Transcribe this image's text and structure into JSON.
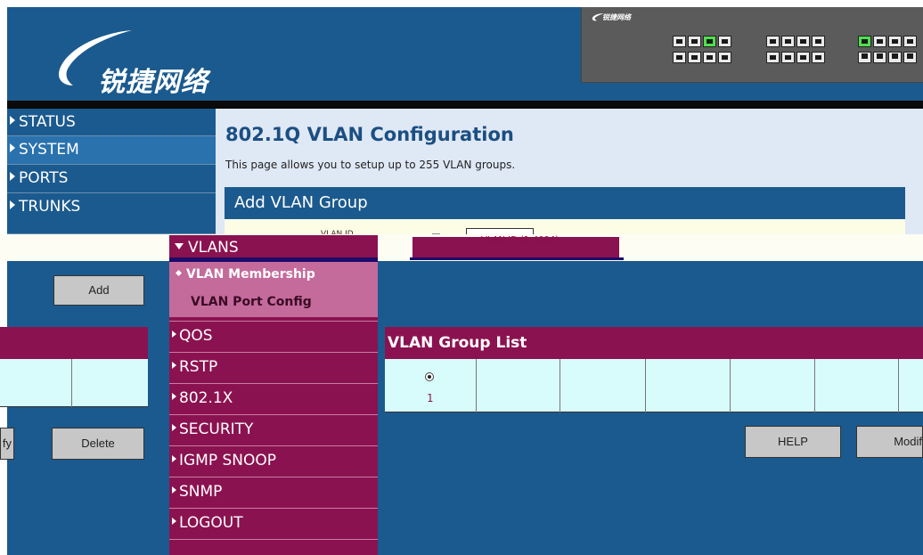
{
  "header": {
    "logo_text": "锐捷网络",
    "switch_brand": "锐捷网络"
  },
  "nav": {
    "items": [
      {
        "label": "STATUS"
      },
      {
        "label": "SYSTEM"
      },
      {
        "label": "PORTS"
      },
      {
        "label": "TRUNKS"
      }
    ],
    "vlans_label": "VLANS",
    "vlan_sub": [
      {
        "label": "VLAN Membership"
      },
      {
        "label": "VLAN Port Config"
      }
    ],
    "more_items": [
      {
        "label": "QOS"
      },
      {
        "label": "RSTP"
      },
      {
        "label": "802.1X"
      },
      {
        "label": "SECURITY"
      },
      {
        "label": "IGMP SNOOP"
      },
      {
        "label": "SNMP"
      },
      {
        "label": "LOGOUT"
      }
    ]
  },
  "main": {
    "title": "802.1Q VLAN Configuration",
    "description": "This page allows you to setup up to 255 VLAN groups.",
    "add_group_header": "Add VLAN Group",
    "vlan_id_label": "VLAN ID",
    "vlan_id_hint": "VLAN ID (1-4094)",
    "group_list_header": "VLAN Group List",
    "group_list": [
      {
        "id": "1",
        "selected": true
      }
    ]
  },
  "buttons": {
    "add": "Add",
    "delete": "Delete",
    "modify_left": "fy",
    "help": "HELP",
    "modify": "Modif"
  },
  "colors": {
    "nav_blue": "#1b5a8e",
    "menu_magenta": "#8b1250",
    "submenu_pink": "#c46b9c",
    "content_bg": "#dfe8f5",
    "list_row": "#d8fbfb"
  }
}
